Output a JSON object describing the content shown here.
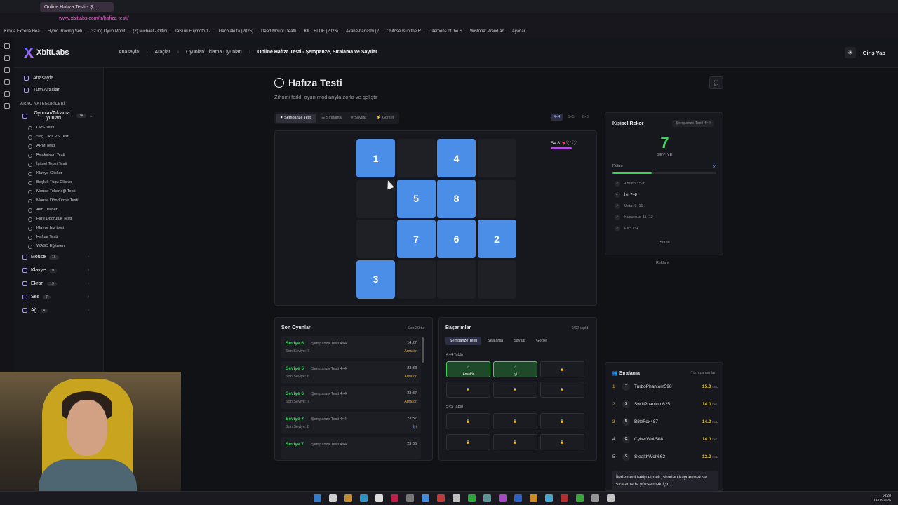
{
  "browser": {
    "tab_title": "Online Hafıza Testi - Ş...",
    "url": "www.xbitlabs.com/tr/hafiza-testi/",
    "bookmarks": [
      "Kioxia Exceria Hea...",
      "Hymo iRacing Setu...",
      "32 inç Oyun Monit...",
      "(2) Michael - Offici...",
      "Tatsuki Fujimoto 17...",
      "Gachiakuta (2025)...",
      "Dead Mount Death...",
      "KILL BLUE (2026)...",
      "Akane-banashi (2...",
      "Chitose Is in the R...",
      "Daemons of the S...",
      "Wistoria: Wand an...",
      "Ayarlar"
    ]
  },
  "header": {
    "logo": "XbitLabs",
    "breadcrumbs": [
      "Anasayfa",
      "Araçlar",
      "Oyunlar/Tıklama Oyunları",
      "Online Hafıza Testi - Şempanze, Sıralama ve Sayılar"
    ],
    "login": "Giriş Yap"
  },
  "sidebar": {
    "home": "Anasayfa",
    "all_tools": "Tüm Araçlar",
    "categories_heading": "ARAÇ KATEGORİLERİ",
    "games_category": {
      "label": "Oyunlar/Tıklama Oyunları",
      "count": "14"
    },
    "games_items": [
      "CPS Testi",
      "Sağ Tık CPS Testi",
      "APM Testi",
      "Reaksiyon Testi",
      "İşitsel Tepki Testi",
      "Klavye Clicker",
      "Boşluk Tuşu Clicker",
      "Mouse Tekerleği Testi",
      "Mouse Döndürme Testi",
      "Aim Trainer",
      "Fare Doğruluk Testi",
      "Klavye hız testi",
      "Hafıza Testi",
      "WASD Eğitmeni"
    ],
    "groups": [
      {
        "label": "Mouse",
        "count": "16"
      },
      {
        "label": "Klavye",
        "count": "9"
      },
      {
        "label": "Ekran",
        "count": "19"
      },
      {
        "label": "Ses",
        "count": "7"
      },
      {
        "label": "Ağ",
        "count": "4"
      }
    ]
  },
  "page": {
    "title": "Hafıza Testi",
    "subtitle": "Zihnini farklı oyun modlarıyla zorla ve geliştir",
    "modes": [
      "Şempanze Testi",
      "Sıralama",
      "Sayılar",
      "Görsel"
    ],
    "sizes": [
      "4×4",
      "5×5",
      "6×6"
    ]
  },
  "board": {
    "level_label": "Sv 8",
    "lives": 1,
    "max_lives": 3,
    "cells": [
      "1",
      "",
      "4",
      "",
      "",
      "5",
      "8",
      "",
      "",
      "7",
      "6",
      "2",
      "3",
      "",
      "",
      ""
    ]
  },
  "record": {
    "title": "Kişisel Rekor",
    "tag": "Şempanze Testi 4×4",
    "value": "7",
    "value_label": "SEVİYE",
    "rank_label": "Rütbe",
    "rank_value": "İyi",
    "rank_progress": 0.38,
    "tiers": [
      "Amatör: 5–6",
      "İyi: 7–8",
      "Usta: 9–10",
      "Kusursuz: 11–12",
      "Elit: 13+"
    ],
    "reset": "Sıfırla",
    "ad": "Reklam"
  },
  "recent": {
    "title": "Son Oyunlar",
    "range": "Son 20 tur",
    "games": [
      {
        "level": "Seviye 6",
        "mode": "Şempanze Testi 4×4",
        "time": "14:27",
        "best": "Son Seviye: 7",
        "rank": "Amatör"
      },
      {
        "level": "Seviye 5",
        "mode": "Şempanze Testi 4×4",
        "time": "23:38",
        "best": "Son Seviye: 6",
        "rank": "Amatör"
      },
      {
        "level": "Seviye 6",
        "mode": "Şempanze Testi 4×4",
        "time": "23:37",
        "best": "Son Seviye: 7",
        "rank": "Amatör"
      },
      {
        "level": "Seviye 7",
        "mode": "Şempanze Testi 4×4",
        "time": "23:37",
        "best": "Son Seviye: 8",
        "rank": "İyi"
      },
      {
        "level": "Seviye 7",
        "mode": "Şempanze Testi 4×4",
        "time": "23:36",
        "best": "",
        "rank": ""
      }
    ]
  },
  "achievements": {
    "title": "Başarımlar",
    "count": "9/60 açıldı",
    "tabs": [
      "Şempanze Testi",
      "Sıralama",
      "Sayılar",
      "Görsel"
    ],
    "group1": "4×4 Tablo",
    "group2": "5×5 Tablo",
    "earned": [
      "Amatör",
      "İyi"
    ]
  },
  "leaderboard": {
    "title": "Sıralama",
    "range": "Tüm zamanlar",
    "unit": "LVL",
    "rows": [
      {
        "pos": "1",
        "initial": "T",
        "name": "TurboPhantom598",
        "score": "15.0"
      },
      {
        "pos": "2",
        "initial": "S",
        "name": "SwiftPhantom625",
        "score": "14.0"
      },
      {
        "pos": "3",
        "initial": "B",
        "name": "BlitzFox487",
        "score": "14.0"
      },
      {
        "pos": "4",
        "initial": "C",
        "name": "CyberWolf508",
        "score": "14.0"
      },
      {
        "pos": "5",
        "initial": "S",
        "name": "StealthWolf662",
        "score": "12.0"
      }
    ],
    "footer": "İlerlemeni takip etmek, skorları kaydetmek ve sıralamada yükselmek için"
  },
  "taskbar": {
    "time": "14:28",
    "date": "14.08.2026"
  }
}
